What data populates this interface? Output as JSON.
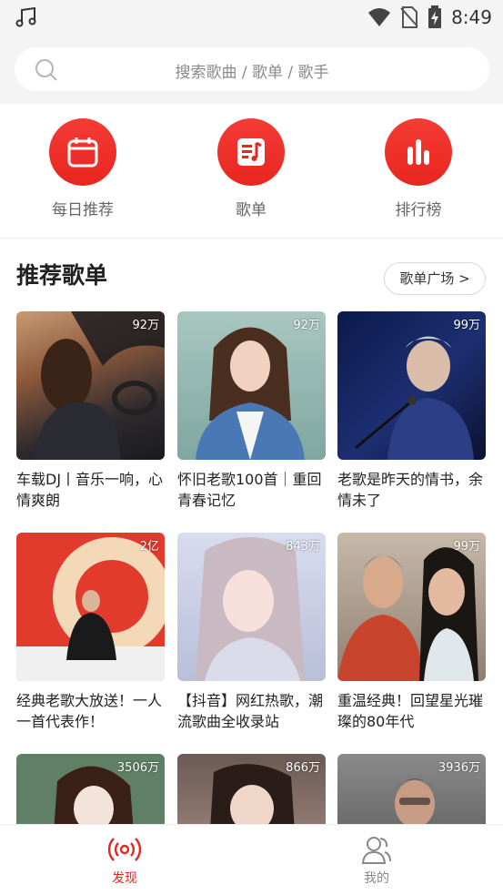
{
  "status_bar": {
    "time": "8:49"
  },
  "search": {
    "placeholder": "搜索歌曲 / 歌单 / 歌手"
  },
  "categories": [
    {
      "label": "每日推荐",
      "icon": "calendar-icon"
    },
    {
      "label": "歌单",
      "icon": "playlist-icon"
    },
    {
      "label": "排行榜",
      "icon": "chart-bars-icon"
    }
  ],
  "section": {
    "title": "推荐歌单",
    "more_label": "歌单广场 >"
  },
  "playlists": [
    {
      "title": "车载DJ丨音乐一响，心情爽朗",
      "count": "92万"
    },
    {
      "title": "怀旧老歌100首｜重回青春记忆",
      "count": "92万"
    },
    {
      "title": "老歌是昨天的情书，余情未了",
      "count": "99万"
    },
    {
      "title": "经典老歌大放送！一人一首代表作！",
      "count": "2亿"
    },
    {
      "title": "【抖音】网红热歌，潮流歌曲全收录站",
      "count": "843万"
    },
    {
      "title": "重温经典！回望星光璀璨的80年代",
      "count": "99万"
    },
    {
      "title": "",
      "count": "3506万"
    },
    {
      "title": "",
      "count": "866万"
    },
    {
      "title": "",
      "count": "3936万"
    }
  ],
  "bottom_nav": {
    "discover": "发现",
    "mine": "我的"
  },
  "colors": {
    "accent": "#e8261f",
    "background": "#f4f4f4"
  }
}
